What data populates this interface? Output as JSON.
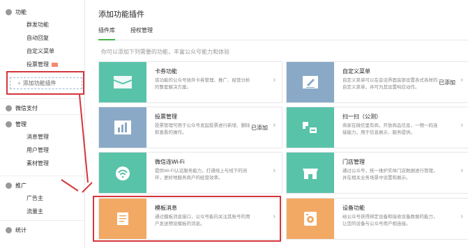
{
  "sidebar": {
    "groups": [
      {
        "label": "功能",
        "items": [
          "群发功能",
          "自动回复",
          "自定义菜单",
          "投票管理"
        ]
      },
      {
        "label": "微信支付",
        "items": []
      },
      {
        "label": "管理",
        "items": [
          "消息管理",
          "用户管理",
          "素材管理"
        ]
      },
      {
        "label": "推广",
        "items": [
          "广告主",
          "流量主"
        ]
      },
      {
        "label": "统计",
        "items": []
      }
    ],
    "add_plugin_label": "添加功能插件"
  },
  "main": {
    "title": "添加功能插件",
    "tabs": [
      "插件库",
      "授权管理"
    ],
    "intro": "你可以添加下列需要的功能，丰富公众号能力和体验",
    "plugins": [
      {
        "name": "卡券功能",
        "desc": "该功能的公众号插件卡券管理、推广、经营分析的整套解决方案。",
        "status": "",
        "color": "#59c3a9"
      },
      {
        "name": "自定义菜单",
        "desc": "自定义菜单可以在会话界面底部设置各式各样的自定义菜单，并可为其设置响应动作。",
        "status": "已添加",
        "color": "#8aa9c6"
      },
      {
        "name": "投票管理",
        "desc": "投票管理可用于公众号发起投票进行新增、删除和查看的操作。",
        "status": "已添加",
        "color": "#8aa9c6"
      },
      {
        "name": "扫一扫（公测）",
        "desc": "商家在微信里有商，开放商品信息，一物一码连接能力，用于信息展示、服务提供。",
        "status": "",
        "color": "#59c3a9"
      },
      {
        "name": "微信连Wi-Fi",
        "desc": "提供Wi-Fi认证服务能力，打通线上与线下的闭环，更好地服务商户的经营效率。",
        "status": "",
        "color": "#59c3a9"
      },
      {
        "name": "门店管理",
        "desc": "通过公众号，统一维护实体门店数据进行管理，并在相关业务场景中设置和展示。",
        "status": "",
        "color": "#59c3a9"
      },
      {
        "name": "模板消息",
        "desc": "通过模板消息接口，公众号能向关注其账号的用户发送预设模板的消息。",
        "status": "",
        "color": "#f2a964"
      },
      {
        "name": "设备功能",
        "desc": "给公众号获得绑定设备和接收设备数据的能力，让您的设备与公众号用户相连接。",
        "status": "",
        "color": "#f2a964"
      }
    ]
  },
  "colors": {
    "accent": "#44b549",
    "highlight": "#d4363b"
  }
}
